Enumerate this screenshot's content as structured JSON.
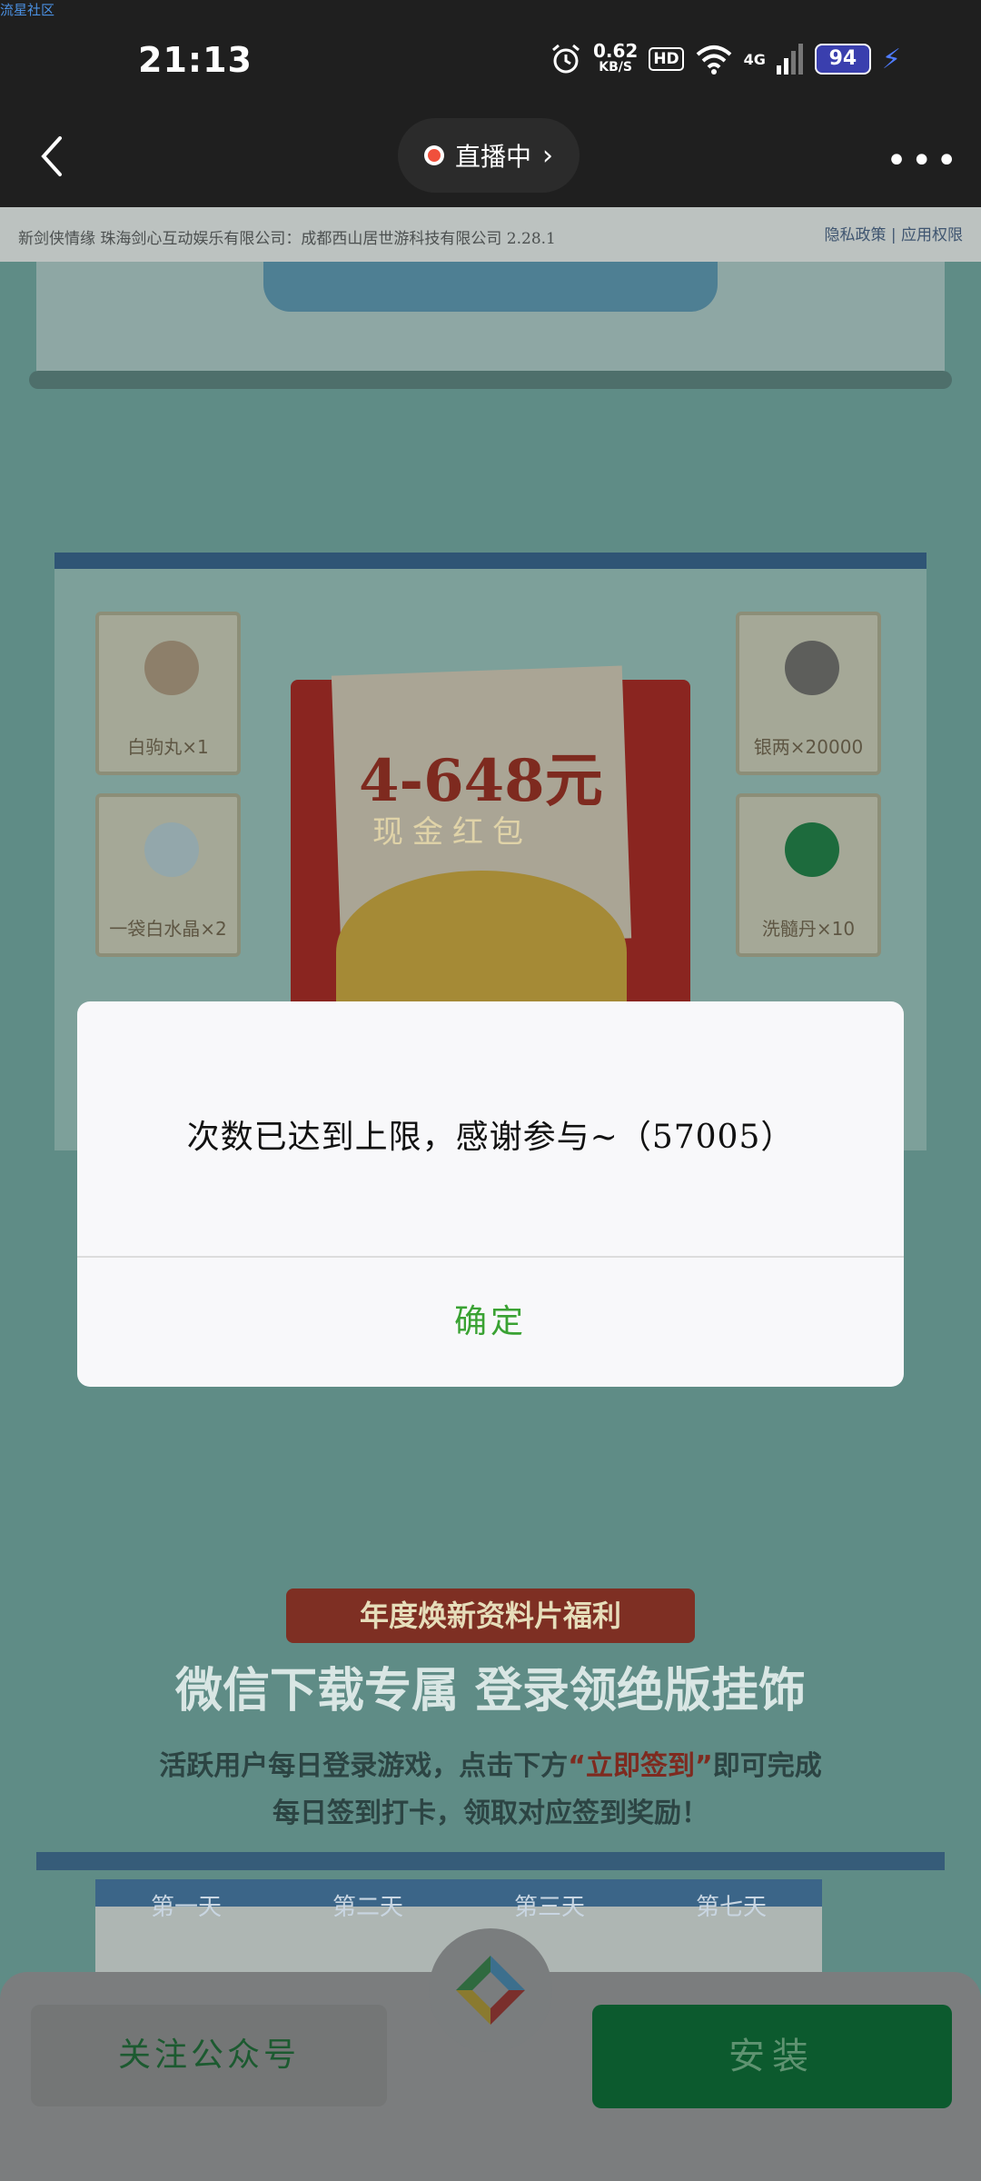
{
  "watermark": "流星社区",
  "status_bar": {
    "time": "21:13",
    "net_speed_value": "0.62",
    "net_speed_unit": "KB/S",
    "hd_label": "HD",
    "signal_label": "4G",
    "battery": "94"
  },
  "nav": {
    "live_label": "直播中"
  },
  "page": {
    "publisher_line": "新剑侠情缘   珠海剑心互动娱乐有限公司：成都西山居世游科技有限公司   2.28.1",
    "privacy_links": "隐私政策  |  应用权限",
    "rewards_left": [
      "白驹丸×1",
      "一袋白水晶×2"
    ],
    "rewards_right": [
      "银两×20000",
      "洗髓丹×10"
    ],
    "red_packet_amount": "4-648元",
    "red_packet_label": "现金红包",
    "banner_ribbon": "年度焕新资料片福利",
    "banner_title": "微信下载专属  登录领绝版挂饰",
    "banner_desc_1a": "活跃用户每日登录游戏，点击下方",
    "banner_desc_1b": "“立即签到”",
    "banner_desc_1c": "即可完成",
    "banner_desc_2": "每日签到打卡，领取对应签到奖励！",
    "days": [
      "第一天",
      "第二天",
      "第三天",
      "第七天"
    ]
  },
  "dialog": {
    "message": "次数已达到上限，感谢参与~（57005）",
    "confirm_label": "确定"
  },
  "bottom": {
    "follow_label": "关注公众号",
    "install_label": "安装"
  },
  "colors": {
    "dialog_confirm": "#3aa233",
    "install_button": "#0c5a2e",
    "live_dot": "#f0503c"
  }
}
